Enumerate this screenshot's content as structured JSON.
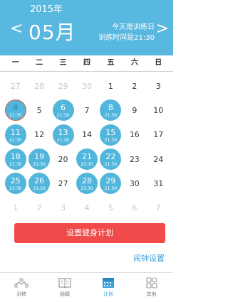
{
  "header": {
    "year": "2015年",
    "month": "05月",
    "today_line1": "今天是训练日",
    "today_line2": "训练时间是21:30",
    "prev": "<",
    "next": ">"
  },
  "weekdays": [
    "一",
    "二",
    "三",
    "四",
    "五",
    "六",
    "日"
  ],
  "calendar": [
    [
      {
        "d": "27",
        "o": true
      },
      {
        "d": "28",
        "o": true
      },
      {
        "d": "29",
        "o": true
      },
      {
        "d": "30",
        "o": true
      },
      {
        "d": "1"
      },
      {
        "d": "2"
      },
      {
        "d": "3"
      }
    ],
    [
      {
        "d": "4",
        "t": "21:30",
        "today": true
      },
      {
        "d": "5"
      },
      {
        "d": "6",
        "t": "21:30"
      },
      {
        "d": "7"
      },
      {
        "d": "8",
        "t": "21:30"
      },
      {
        "d": "9"
      },
      {
        "d": "10"
      }
    ],
    [
      {
        "d": "11",
        "t": "21:30"
      },
      {
        "d": "12"
      },
      {
        "d": "13",
        "t": "21:30"
      },
      {
        "d": "14"
      },
      {
        "d": "15",
        "t": "21:30"
      },
      {
        "d": "16"
      },
      {
        "d": "17"
      }
    ],
    [
      {
        "d": "18",
        "t": "21:30"
      },
      {
        "d": "19",
        "t": "21:30"
      },
      {
        "d": "20"
      },
      {
        "d": "21",
        "t": "21:30"
      },
      {
        "d": "22",
        "t": "21:30"
      },
      {
        "d": "23"
      },
      {
        "d": "24"
      }
    ],
    [
      {
        "d": "25",
        "t": "21:30"
      },
      {
        "d": "26",
        "t": "21:30"
      },
      {
        "d": "27"
      },
      {
        "d": "28",
        "t": "21:30"
      },
      {
        "d": "29",
        "t": "21:30"
      },
      {
        "d": "30"
      },
      {
        "d": "31"
      }
    ],
    [
      {
        "d": "1",
        "o": true
      },
      {
        "d": "2",
        "o": true
      },
      {
        "d": "3",
        "o": true
      },
      {
        "d": "4",
        "o": true
      },
      {
        "d": "5",
        "o": true
      },
      {
        "d": "6",
        "o": true
      },
      {
        "d": "7",
        "o": true
      }
    ]
  ],
  "actions": {
    "plan_button": "设置健身计划",
    "alarm_link": "闹钟设置"
  },
  "nav": [
    {
      "label": "训练",
      "icon": "dumbbell-icon"
    },
    {
      "label": "秘籍",
      "icon": "book-icon"
    },
    {
      "label": "计划",
      "icon": "calendar-icon",
      "active": true
    },
    {
      "label": "其他",
      "icon": "grid-icon"
    }
  ],
  "colors": {
    "header_bg": "#59b8e0",
    "training_day": "#52b6dc",
    "today_ring": "#e0593d",
    "plan_button": "#f04a4a",
    "link": "#3a9fd8"
  }
}
